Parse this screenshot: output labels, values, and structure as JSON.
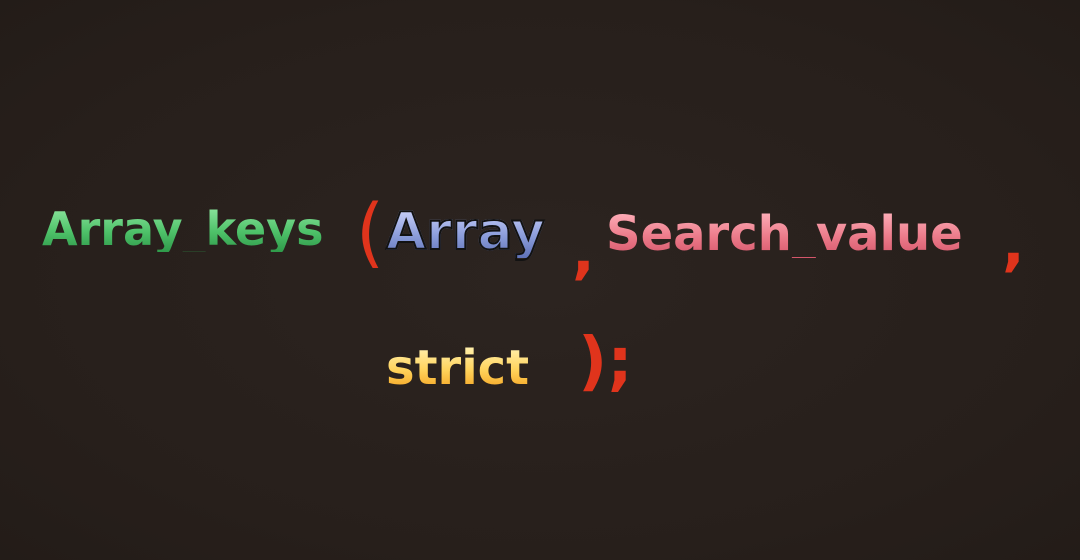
{
  "background_color": "#271f1b",
  "colors": {
    "function": "#4fc26a",
    "arg_array": "#8e9fdc",
    "arg_search": "#ec7b8a",
    "arg_strict": "#ffd25a",
    "punctuation": "#e0341c"
  },
  "code": {
    "function_name": "Array_keys",
    "open_paren": "(",
    "arg1": "Array",
    "comma1": ",",
    "arg2": "Search_value",
    "comma2": ",",
    "arg3": "strict",
    "close": ");"
  }
}
